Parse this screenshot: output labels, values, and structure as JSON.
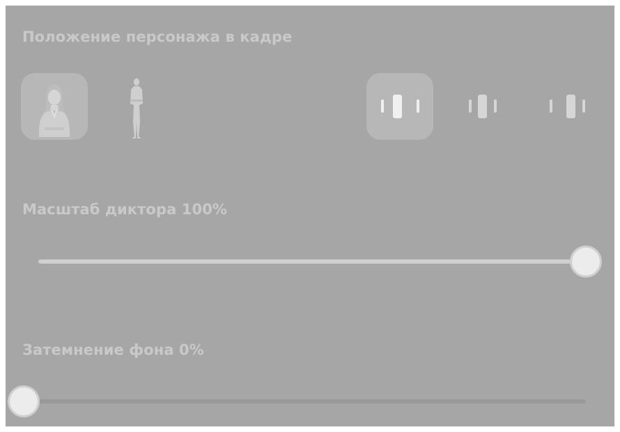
{
  "position_section": {
    "title": "Положение персонажа в кадре",
    "framing_options": [
      {
        "name": "portrait",
        "icon": "portrait-framing-icon",
        "selected": true
      },
      {
        "name": "full-body",
        "icon": "full-body-framing-icon",
        "selected": false
      }
    ],
    "alignment_options": [
      {
        "name": "left",
        "icon": "align-left-icon",
        "selected": true
      },
      {
        "name": "center",
        "icon": "align-center-icon",
        "selected": false
      },
      {
        "name": "right",
        "icon": "align-right-icon",
        "selected": false
      }
    ]
  },
  "scale_section": {
    "title": "Масштаб диктора 100%",
    "value_percent": 100
  },
  "dim_section": {
    "title": "Затемнение фона 0%",
    "value_percent": 0
  },
  "colors": {
    "panel_background": "#a6a6a6",
    "text": "#c9c9c9",
    "active_tile": "#b7b7b7",
    "track": "#999999",
    "track_fill": "#d0d0d0",
    "thumb": "#ececec"
  }
}
